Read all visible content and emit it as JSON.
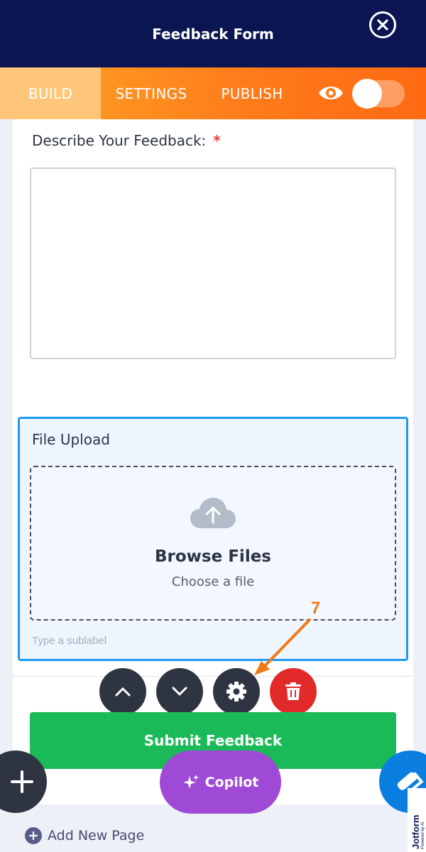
{
  "header": {
    "title": "Feedback Form"
  },
  "tabs": [
    {
      "label": "BUILD",
      "active": true
    },
    {
      "label": "SETTINGS",
      "active": false
    },
    {
      "label": "PUBLISH",
      "active": false
    }
  ],
  "preview": {
    "icon": "eye-icon",
    "toggle_on": false
  },
  "form": {
    "question_label": "Describe Your Feedback:",
    "required_mark": "*",
    "textarea_value": "",
    "upload": {
      "label": "File Upload",
      "browse": "Browse Files",
      "choose": "Choose a file",
      "sublabel_placeholder": "Type a sublabel"
    },
    "submit_label": "Submit Feedback"
  },
  "toolbar": {
    "icons": [
      "chevron-up-icon",
      "chevron-down-icon",
      "gear-icon",
      "trash-icon"
    ]
  },
  "annotation": {
    "step_number": "7",
    "color": "#f07a16"
  },
  "fabs": {
    "copilot_label": "Copilot"
  },
  "brand": {
    "name": "Jotform",
    "tagline": "Powered by AI"
  },
  "footer": {
    "add_page_label": "Add New Page"
  },
  "colors": {
    "header_bg": "#0b1551",
    "tab_gradient_start": "#ffa626",
    "tab_gradient_end": "#ff6a13",
    "selected_border": "#1b9af0",
    "submit_bg": "#1bba58",
    "copilot_bg": "#9e4ad6",
    "delete_bg": "#e22a2a"
  }
}
